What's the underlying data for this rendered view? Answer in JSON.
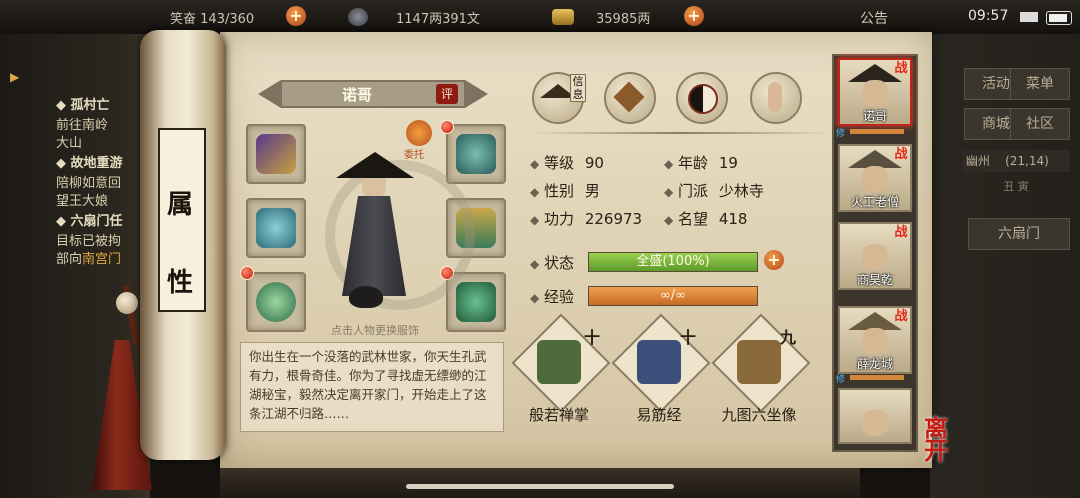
{
  "topbar": {
    "resource1_prefix": "笑奋",
    "resource1": "143/360",
    "copper": "1147两391文",
    "silver": "35985两",
    "notice": "公告",
    "time": "09:57"
  },
  "quests": [
    {
      "title": "孤村亡",
      "lines": [
        "前往南岭",
        "大山"
      ]
    },
    {
      "title": "故地重游",
      "lines": [
        "陪柳如意回",
        "望王大娘"
      ]
    },
    {
      "title": "六扇门任",
      "lines": [
        "目标已被拘",
        "部向南宫门"
      ],
      "highlight": "南宫门"
    }
  ],
  "right_menu": {
    "activity": "活动",
    "menu": "菜单",
    "shop": "商城",
    "community": "社区",
    "location": "幽州",
    "coords": "(21,14)",
    "time_of_day": "丑 寅",
    "faction_tab": "六扇门"
  },
  "scroll": {
    "tab_chars": [
      "属",
      "性"
    ]
  },
  "character": {
    "name": "诺哥",
    "rate_badge": "评",
    "commission_label": "委托",
    "change_outfit_hint": "点击人物更换服饰",
    "bio": "你出生在一个没落的武林世家，你天生孔武有力，根骨奇佳。你为了寻找虚无缥缈的江湖秘宝，毅然决定离开家门，开始走上了这条江湖不归路……"
  },
  "info_tabs": {
    "info_label": "信息"
  },
  "stats": {
    "level_label": "等级",
    "level": "90",
    "age_label": "年龄",
    "age": "19",
    "gender_label": "性别",
    "gender": "男",
    "sect_label": "门派",
    "sect": "少林寺",
    "power_label": "功力",
    "power": "226973",
    "fame_label": "名望",
    "fame": "418",
    "status_label": "状态",
    "status_value": "全盛(100%)",
    "status_fill": 1.0,
    "exp_label": "经验",
    "exp_value": "∞/∞",
    "exp_fill": 1.0
  },
  "skills": [
    {
      "name": "般若禅掌",
      "rank": "十",
      "color": "#4f6b3c"
    },
    {
      "name": "易筋经",
      "rank": "十",
      "color": "#3a4f7a"
    },
    {
      "name": "九图六坐像",
      "rank": "九",
      "color": "#8a6a3a"
    }
  ],
  "party": [
    {
      "name": "诺哥",
      "selected": true,
      "badge": "战",
      "xiu": "修"
    },
    {
      "name": "火工老僧",
      "selected": false,
      "badge": "战",
      "xiu": ""
    },
    {
      "name": "商昊乾",
      "selected": false,
      "badge": "战",
      "xiu": ""
    },
    {
      "name": "薛龙城",
      "selected": false,
      "badge": "战",
      "xiu": "修"
    },
    {
      "name": "",
      "selected": false,
      "badge": "",
      "xiu": ""
    }
  ],
  "leave_button": [
    "离",
    "开"
  ]
}
